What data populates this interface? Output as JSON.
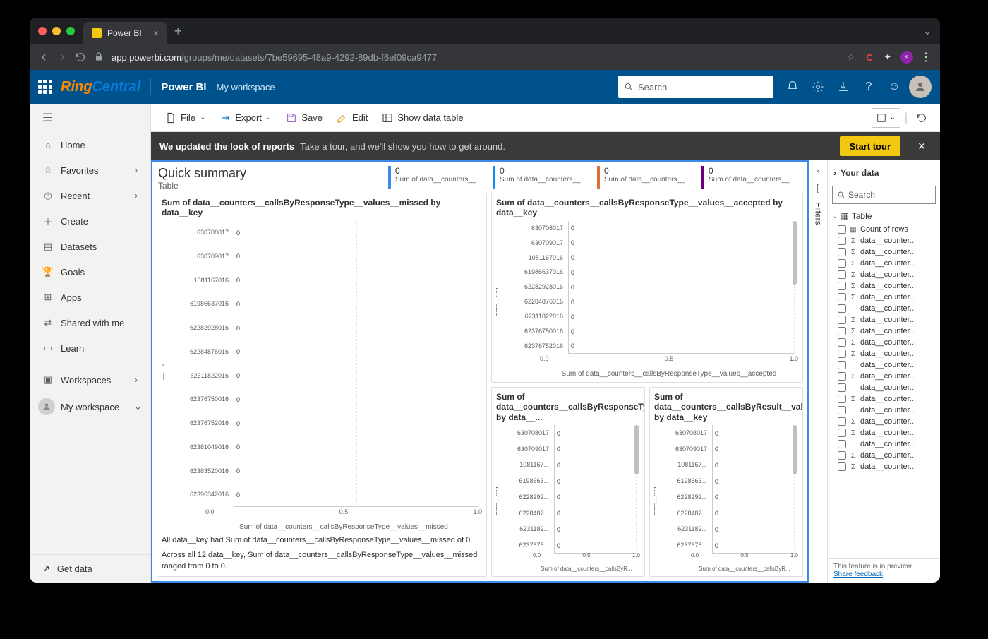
{
  "browser": {
    "tabTitle": "Power BI",
    "url_host": "app.powerbi.com",
    "url_path": "/groups/me/datasets/7be59695-48a9-4292-89db-f6ef09ca9477",
    "avatar_letter": "s"
  },
  "appHeader": {
    "brand1": "Ring",
    "brand2": "Central",
    "product": "Power BI",
    "workspace": "My workspace",
    "searchPlaceholder": "Search"
  },
  "sidenav": {
    "items": [
      {
        "icon": "home",
        "label": "Home"
      },
      {
        "icon": "star",
        "label": "Favorites",
        "chev": true
      },
      {
        "icon": "clock",
        "label": "Recent",
        "chev": true
      },
      {
        "icon": "plus",
        "label": "Create"
      },
      {
        "icon": "db",
        "label": "Datasets"
      },
      {
        "icon": "trophy",
        "label": "Goals"
      },
      {
        "icon": "apps",
        "label": "Apps"
      },
      {
        "icon": "share",
        "label": "Shared with me"
      },
      {
        "icon": "learn",
        "label": "Learn"
      }
    ],
    "workspaces": "Workspaces",
    "myworkspace": "My workspace",
    "getdata": "Get data"
  },
  "toolbar": {
    "file": "File",
    "export": "Export",
    "save": "Save",
    "edit": "Edit",
    "showdata": "Show data table"
  },
  "banner": {
    "bold": "We updated the look of reports",
    "text": "Take a tour, and we'll show you how to get around.",
    "button": "Start tour"
  },
  "summary": {
    "title": "Quick summary",
    "subtitle": "Table",
    "kpis": [
      {
        "color": "#3b8ce8",
        "value": "0",
        "label": "Sum of data__counters__..."
      },
      {
        "color": "#118dff",
        "value": "0",
        "label": "Sum of data__counters__..."
      },
      {
        "color": "#e66c37",
        "value": "0",
        "label": "Sum of data__counters__..."
      },
      {
        "color": "#6b007b",
        "value": "0",
        "label": "Sum of data__counters__..."
      }
    ]
  },
  "chart_data": [
    {
      "type": "bar",
      "title": "Sum of data__counters__callsByResponseType__values__missed by data__key",
      "ylabel_axis": "data__key",
      "categories": [
        "630708017",
        "630709017",
        "1081167016",
        "61986637016",
        "62282928016",
        "62284876016",
        "62311822016",
        "62376750016",
        "62376752016",
        "62381049016",
        "62383520016",
        "62396342016"
      ],
      "values": [
        0,
        0,
        0,
        0,
        0,
        0,
        0,
        0,
        0,
        0,
        0,
        0
      ],
      "value_labels": [
        "0",
        "0",
        "0",
        "0",
        "0",
        "0",
        "0",
        "0",
        "0",
        "0",
        "0",
        "0"
      ],
      "xlim": [
        0.0,
        1.0
      ],
      "xticks": [
        "0.0",
        "0.5",
        "1.0"
      ],
      "xlabel": "Sum of data__counters__callsByResponseType__values__missed",
      "insights": [
        "All data__key had Sum of data__counters__callsByResponseType__values__missed of 0.",
        "Across all 12 data__key, Sum of data__counters__callsByResponseType__values__missed ranged from 0 to 0."
      ]
    },
    {
      "type": "bar",
      "title": "Sum of data__counters__callsByResponseType__values__accepted by data__key",
      "ylabel_axis": "data__key",
      "categories": [
        "630708017",
        "630709017",
        "1081167016",
        "61986637016",
        "62282928016",
        "62284876016",
        "62311822016",
        "62376750016",
        "62376752016"
      ],
      "values": [
        0,
        0,
        0,
        0,
        0,
        0,
        0,
        0,
        0
      ],
      "value_labels": [
        "0",
        "0",
        "0",
        "0",
        "0",
        "0",
        "0",
        "0",
        "0"
      ],
      "xlim": [
        0.0,
        1.0
      ],
      "xticks": [
        "0.0",
        "0.5",
        "1.0"
      ],
      "xlabel": "Sum of data__counters__callsByResponseType__values__accepted"
    },
    {
      "type": "bar",
      "title": "Sum of data__counters__callsByResponseType__values__parkRetrieval by data__...",
      "ylabel_axis": "data__key",
      "categories": [
        "630708017",
        "630709017",
        "1081167...",
        "6198663...",
        "6228292...",
        "6228487...",
        "6231182...",
        "6237675..."
      ],
      "values": [
        0,
        0,
        0,
        0,
        0,
        0,
        0,
        0
      ],
      "value_labels": [
        "0",
        "0",
        "0",
        "0",
        "0",
        "0",
        "0",
        "0"
      ],
      "xlim": [
        0.0,
        1.0
      ],
      "xticks": [
        "0.0",
        "0.5",
        "1.0"
      ],
      "xlabel": "Sum of data__counters__callsByR..."
    },
    {
      "type": "bar",
      "title": "Sum of data__counters__callsByResult__values__completed by data__key",
      "ylabel_axis": "data__key",
      "categories": [
        "630708017",
        "630709017",
        "1081167...",
        "6198663...",
        "6228292...",
        "6228487...",
        "6231182...",
        "6237675..."
      ],
      "values": [
        0,
        0,
        0,
        0,
        0,
        0,
        0,
        0
      ],
      "value_labels": [
        "0",
        "0",
        "0",
        "0",
        "0",
        "0",
        "0",
        "0"
      ],
      "xlim": [
        0.0,
        1.0
      ],
      "xticks": [
        "0.0",
        "0.5",
        "1.0"
      ],
      "xlabel": "Sum of data__counters__callsByR..."
    }
  ],
  "filtersRail": {
    "label": "Filters"
  },
  "dataPane": {
    "title": "Your data",
    "searchPlaceholder": "Search",
    "tableName": "Table",
    "fields": [
      {
        "icon": "table",
        "name": "Count of rows"
      },
      {
        "icon": "sigma",
        "name": "data__counter..."
      },
      {
        "icon": "sigma",
        "name": "data__counter..."
      },
      {
        "icon": "sigma",
        "name": "data__counter..."
      },
      {
        "icon": "sigma",
        "name": "data__counter..."
      },
      {
        "icon": "sigma",
        "name": "data__counter..."
      },
      {
        "icon": "sigma",
        "name": "data__counter..."
      },
      {
        "icon": "",
        "name": "data__counter..."
      },
      {
        "icon": "sigma",
        "name": "data__counter..."
      },
      {
        "icon": "sigma",
        "name": "data__counter..."
      },
      {
        "icon": "sigma",
        "name": "data__counter..."
      },
      {
        "icon": "sigma",
        "name": "data__counter..."
      },
      {
        "icon": "",
        "name": "data__counter..."
      },
      {
        "icon": "sigma",
        "name": "data__counter..."
      },
      {
        "icon": "",
        "name": "data__counter..."
      },
      {
        "icon": "sigma",
        "name": "data__counter..."
      },
      {
        "icon": "",
        "name": "data__counter..."
      },
      {
        "icon": "sigma",
        "name": "data__counter..."
      },
      {
        "icon": "sigma",
        "name": "data__counter..."
      },
      {
        "icon": "",
        "name": "data__counter..."
      },
      {
        "icon": "sigma",
        "name": "data__counter..."
      },
      {
        "icon": "sigma",
        "name": "data__counter..."
      }
    ],
    "previewText": "This feature is in preview.",
    "shareLink": "Share feedback"
  }
}
